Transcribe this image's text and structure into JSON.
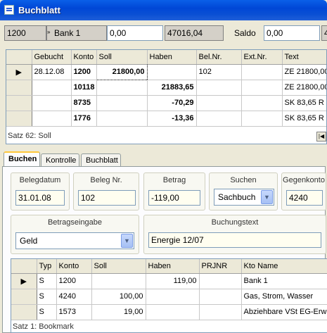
{
  "window": {
    "title": "Buchblatt"
  },
  "header": {
    "konto_nr": "1200",
    "konto_name": "Bank 1",
    "betrag": "0,00",
    "stand": "47016,04",
    "saldo_label": "Saldo",
    "saldo_value": "0,00",
    "extra": "4"
  },
  "main_grid": {
    "columns": [
      "Gebucht",
      "Konto",
      "Soll",
      "Haben",
      "Bel.Nr.",
      "Ext.Nr.",
      "Text"
    ],
    "rows": [
      {
        "gebucht": "28.12.08",
        "konto": "1200",
        "soll": "21800,00",
        "haben": "",
        "belnr": "102",
        "extnr": "",
        "text": "ZE 21800,00"
      },
      {
        "gebucht": "",
        "konto": "10118",
        "soll": "",
        "haben": "21883,65",
        "belnr": "",
        "extnr": "",
        "text": "ZE 21800,00"
      },
      {
        "gebucht": "",
        "konto": "8735",
        "soll": "",
        "haben": "-70,29",
        "belnr": "",
        "extnr": "",
        "text": "SK 83,65 R"
      },
      {
        "gebucht": "",
        "konto": "1776",
        "soll": "",
        "haben": "-13,36",
        "belnr": "",
        "extnr": "",
        "text": "SK 83,65 R"
      }
    ],
    "status": "Satz 62: Soll"
  },
  "tabs": [
    {
      "label": "Buchen"
    },
    {
      "label": "Kontrolle"
    },
    {
      "label": "Buchblatt"
    }
  ],
  "form": {
    "belegdatum_label": "Belegdatum",
    "belegdatum_value": "31.01.08",
    "belegnr_label": "Beleg Nr.",
    "belegnr_value": "102",
    "betrag_label": "Betrag",
    "betrag_value": "-119,00",
    "suchen_label": "Suchen",
    "suchen_value": "Sachbuch",
    "gegenkonto_label": "Gegenkonto",
    "gegenkonto_value": "4240",
    "betragseingabe_label": "Betragseingabe",
    "betragseingabe_value": "Geld",
    "buchungstext_label": "Buchungstext",
    "buchungstext_value": "Energie 12/07"
  },
  "sub_grid": {
    "columns": [
      "Typ",
      "Konto",
      "Soll",
      "Haben",
      "PRJNR",
      "Kto Name"
    ],
    "rows": [
      {
        "typ": "S",
        "konto": "1200",
        "soll": "",
        "haben": "119,00",
        "prjnr": "",
        "name": "Bank 1"
      },
      {
        "typ": "S",
        "konto": "4240",
        "soll": "100,00",
        "haben": "",
        "prjnr": "",
        "name": "Gas, Strom, Wasser"
      },
      {
        "typ": "S",
        "konto": "1573",
        "soll": "19,00",
        "haben": "",
        "prjnr": "",
        "name": "Abziehbare VSt EG-Erw"
      }
    ],
    "status": "Satz 1: Bookmark"
  },
  "icons": {
    "row_pointer": "triangle-right",
    "nav": "first-record-icon",
    "dropdown": "chevron-down-icon"
  }
}
